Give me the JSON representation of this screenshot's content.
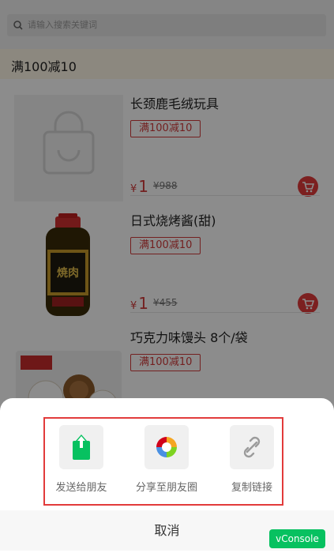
{
  "search": {
    "placeholder": "请输入搜索关键词"
  },
  "promo": {
    "title": "满100减10"
  },
  "products": [
    {
      "name": "长颈鹿毛绒玩具",
      "tag": "满100减10",
      "currency": "¥",
      "price": "1",
      "old_price": "¥988"
    },
    {
      "name": "日式烧烤酱(甜)",
      "tag": "满100减10",
      "currency": "¥",
      "price": "1",
      "old_price": "¥455"
    },
    {
      "name": "巧克力味馒头 8个/袋",
      "tag": "满100减10",
      "currency": "",
      "price": "",
      "old_price": ""
    }
  ],
  "share_sheet": {
    "options": [
      {
        "label": "发送给朋友",
        "icon": "share-to-friend-icon"
      },
      {
        "label": "分享至朋友圈",
        "icon": "moments-icon"
      },
      {
        "label": "复制链接",
        "icon": "link-icon"
      }
    ],
    "cancel_label": "取消"
  },
  "vconsole": {
    "label": "vConsole"
  },
  "colors": {
    "accent": "#e23b3b",
    "wechat_green": "#07c160",
    "highlight_box": "#e23b3b"
  }
}
